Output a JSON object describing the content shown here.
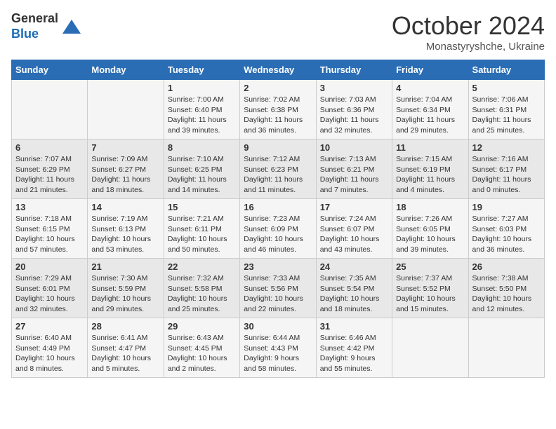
{
  "logo": {
    "line1": "General",
    "line2": "Blue"
  },
  "title": "October 2024",
  "location": "Monastyryshche, Ukraine",
  "days_header": [
    "Sunday",
    "Monday",
    "Tuesday",
    "Wednesday",
    "Thursday",
    "Friday",
    "Saturday"
  ],
  "weeks": [
    [
      {
        "day": "",
        "info": ""
      },
      {
        "day": "",
        "info": ""
      },
      {
        "day": "1",
        "info": "Sunrise: 7:00 AM\nSunset: 6:40 PM\nDaylight: 11 hours and 39 minutes."
      },
      {
        "day": "2",
        "info": "Sunrise: 7:02 AM\nSunset: 6:38 PM\nDaylight: 11 hours and 36 minutes."
      },
      {
        "day": "3",
        "info": "Sunrise: 7:03 AM\nSunset: 6:36 PM\nDaylight: 11 hours and 32 minutes."
      },
      {
        "day": "4",
        "info": "Sunrise: 7:04 AM\nSunset: 6:34 PM\nDaylight: 11 hours and 29 minutes."
      },
      {
        "day": "5",
        "info": "Sunrise: 7:06 AM\nSunset: 6:31 PM\nDaylight: 11 hours and 25 minutes."
      }
    ],
    [
      {
        "day": "6",
        "info": "Sunrise: 7:07 AM\nSunset: 6:29 PM\nDaylight: 11 hours and 21 minutes."
      },
      {
        "day": "7",
        "info": "Sunrise: 7:09 AM\nSunset: 6:27 PM\nDaylight: 11 hours and 18 minutes."
      },
      {
        "day": "8",
        "info": "Sunrise: 7:10 AM\nSunset: 6:25 PM\nDaylight: 11 hours and 14 minutes."
      },
      {
        "day": "9",
        "info": "Sunrise: 7:12 AM\nSunset: 6:23 PM\nDaylight: 11 hours and 11 minutes."
      },
      {
        "day": "10",
        "info": "Sunrise: 7:13 AM\nSunset: 6:21 PM\nDaylight: 11 hours and 7 minutes."
      },
      {
        "day": "11",
        "info": "Sunrise: 7:15 AM\nSunset: 6:19 PM\nDaylight: 11 hours and 4 minutes."
      },
      {
        "day": "12",
        "info": "Sunrise: 7:16 AM\nSunset: 6:17 PM\nDaylight: 11 hours and 0 minutes."
      }
    ],
    [
      {
        "day": "13",
        "info": "Sunrise: 7:18 AM\nSunset: 6:15 PM\nDaylight: 10 hours and 57 minutes."
      },
      {
        "day": "14",
        "info": "Sunrise: 7:19 AM\nSunset: 6:13 PM\nDaylight: 10 hours and 53 minutes."
      },
      {
        "day": "15",
        "info": "Sunrise: 7:21 AM\nSunset: 6:11 PM\nDaylight: 10 hours and 50 minutes."
      },
      {
        "day": "16",
        "info": "Sunrise: 7:23 AM\nSunset: 6:09 PM\nDaylight: 10 hours and 46 minutes."
      },
      {
        "day": "17",
        "info": "Sunrise: 7:24 AM\nSunset: 6:07 PM\nDaylight: 10 hours and 43 minutes."
      },
      {
        "day": "18",
        "info": "Sunrise: 7:26 AM\nSunset: 6:05 PM\nDaylight: 10 hours and 39 minutes."
      },
      {
        "day": "19",
        "info": "Sunrise: 7:27 AM\nSunset: 6:03 PM\nDaylight: 10 hours and 36 minutes."
      }
    ],
    [
      {
        "day": "20",
        "info": "Sunrise: 7:29 AM\nSunset: 6:01 PM\nDaylight: 10 hours and 32 minutes."
      },
      {
        "day": "21",
        "info": "Sunrise: 7:30 AM\nSunset: 5:59 PM\nDaylight: 10 hours and 29 minutes."
      },
      {
        "day": "22",
        "info": "Sunrise: 7:32 AM\nSunset: 5:58 PM\nDaylight: 10 hours and 25 minutes."
      },
      {
        "day": "23",
        "info": "Sunrise: 7:33 AM\nSunset: 5:56 PM\nDaylight: 10 hours and 22 minutes."
      },
      {
        "day": "24",
        "info": "Sunrise: 7:35 AM\nSunset: 5:54 PM\nDaylight: 10 hours and 18 minutes."
      },
      {
        "day": "25",
        "info": "Sunrise: 7:37 AM\nSunset: 5:52 PM\nDaylight: 10 hours and 15 minutes."
      },
      {
        "day": "26",
        "info": "Sunrise: 7:38 AM\nSunset: 5:50 PM\nDaylight: 10 hours and 12 minutes."
      }
    ],
    [
      {
        "day": "27",
        "info": "Sunrise: 6:40 AM\nSunset: 4:49 PM\nDaylight: 10 hours and 8 minutes."
      },
      {
        "day": "28",
        "info": "Sunrise: 6:41 AM\nSunset: 4:47 PM\nDaylight: 10 hours and 5 minutes."
      },
      {
        "day": "29",
        "info": "Sunrise: 6:43 AM\nSunset: 4:45 PM\nDaylight: 10 hours and 2 minutes."
      },
      {
        "day": "30",
        "info": "Sunrise: 6:44 AM\nSunset: 4:43 PM\nDaylight: 9 hours and 58 minutes."
      },
      {
        "day": "31",
        "info": "Sunrise: 6:46 AM\nSunset: 4:42 PM\nDaylight: 9 hours and 55 minutes."
      },
      {
        "day": "",
        "info": ""
      },
      {
        "day": "",
        "info": ""
      }
    ]
  ]
}
